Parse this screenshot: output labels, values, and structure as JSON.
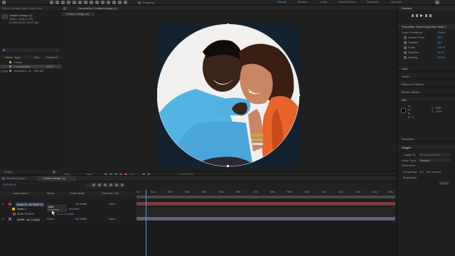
{
  "workspaces": [
    "Default",
    "Review",
    "Learn",
    "Small Screen",
    "Standard",
    "Libraries"
  ],
  "toolbar": {
    "snapping_label": "Snapping"
  },
  "project": {
    "effect_controls_tab": "Effect Controls  Dark Royal Blue",
    "item_name": "Untitled design (1)",
    "item_info1": "1080 x 1080 (1.00)",
    "item_info2": "Δ 0;00;15;00, 29.97 fps",
    "columns": [
      "Name",
      "Type",
      "Size",
      "Frame R..."
    ],
    "rows": [
      {
        "name": "",
        "type": "Folder",
        "size": "",
        "rate": ""
      },
      {
        "name": "",
        "type": "Composition",
        "size": "",
        "rate": "29.97"
      },
      {
        "name": "1).jpg",
        "type": "ImporterJ...G",
        "size": "852 KB",
        "rate": ""
      }
    ],
    "bit_depth": "8 bpc"
  },
  "viewer": {
    "tab_label": "Composition  Untitled design (1)",
    "sub_tab": "Untitled design (1)",
    "zoom": "50%",
    "quality": "(Half)",
    "timecode": "0;00;00;15",
    "exposure": "+0.0"
  },
  "right_panel": {
    "preview_title": "Preview",
    "properties_title": "Properties: Dark Royal Blue Solid 1",
    "layer_transform": "Layer Transform",
    "reset": "Reset",
    "props": [
      {
        "name": "Anchor Point",
        "value": "540"
      },
      {
        "name": "Position",
        "value": "540"
      },
      {
        "name": "Scale",
        "value": "100 %"
      },
      {
        "name": "Rotation",
        "value": "0x+0°"
      },
      {
        "name": "Opacity",
        "value": "100 %"
      }
    ],
    "sections": [
      "Align",
      "Audio",
      "Effects & Presets",
      "Motion Sketch",
      "Info"
    ],
    "info": {
      "r": "R :",
      "g": "G :",
      "b": "B :",
      "a": "A : 0",
      "x": "X : 398",
      "y": "Y : 1104"
    },
    "smoother": "Smoother",
    "wiggler": "Wiggler",
    "apply_to": "Apply To:",
    "apply_to_value": "Temporal Graph",
    "noise_type": "Noise Type:",
    "noise_value": "Smooth",
    "dimensions": "Dimension:",
    "frequency": "Frequency:",
    "frequency_value": "5.0",
    "frequency_unit": "per second",
    "magnitude": "Magnitude:",
    "apply_btn": "Apply"
  },
  "timeline": {
    "render_queue": "Render Queue",
    "comp_tab": "Untitled design (1)",
    "timecode": "0;00;00;15",
    "col_layer_name": "Layer Name",
    "col_mode": "Mode",
    "col_trkmat": "Track Matte",
    "col_parent": "Parent & Link",
    "layers": [
      {
        "num": "1",
        "name": "[Dark R...ue Solid 1]",
        "mode": "Normal",
        "matte": "No Matte",
        "parent": "None"
      },
      {
        "num": "",
        "name": "Mask 1",
        "mode": "Add",
        "matte": "Inverted",
        "parent": ""
      },
      {
        "num": "",
        "name": "Mask Feather",
        "mode": "",
        "matte": "",
        "parent": ""
      },
      {
        "num": "2",
        "name": "[Untitl...gn (1).jpg]",
        "mode": "Norm",
        "matte": "No Matte",
        "parent": "None"
      }
    ],
    "ruler_ticks": [
      "0s",
      "01s",
      "02s",
      "03s",
      "04s",
      "05s",
      "06s",
      "07s",
      "08s",
      "09s",
      "10s",
      "11s",
      "12s",
      "13s",
      "14s",
      "15s"
    ],
    "dropdown": [
      "Add",
      "Subtract",
      "Intersect",
      "Difference"
    ],
    "feather_value": "0.0,0.0 pixels",
    "frame_render": "Frame Render Time  0ms"
  }
}
